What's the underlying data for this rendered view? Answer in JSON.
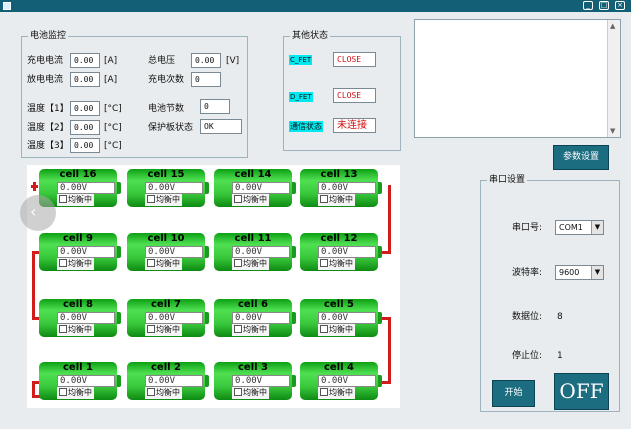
{
  "window": {
    "title": "",
    "controls": [
      "_",
      "□",
      "×"
    ]
  },
  "battery_monitor": {
    "title": "电池监控",
    "charge_current": {
      "label": "充电电流",
      "value": "0.00",
      "unit": "[A]"
    },
    "discharge_current": {
      "label": "放电电流",
      "value": "0.00",
      "unit": "[A]"
    },
    "temp1": {
      "label": "温度【1】",
      "value": "0.00",
      "unit": "[°C]"
    },
    "temp2": {
      "label": "温度【2】",
      "value": "0.00",
      "unit": "[°C]"
    },
    "temp3": {
      "label": "温度【3】",
      "value": "0.00",
      "unit": "[°C]"
    },
    "total_voltage": {
      "label": "总电压",
      "value": "0.00",
      "unit": "[V]"
    },
    "charge_count": {
      "label": "充电次数",
      "value": "0"
    },
    "cell_count": {
      "label": "电池节数",
      "value": "0"
    },
    "protection_status": {
      "label": "保护板状态",
      "value": "OK"
    }
  },
  "other_status": {
    "title": "其他状态",
    "c_fet": {
      "label": "C_FET",
      "value": "CLOSE"
    },
    "d_fet": {
      "label": "D_FET",
      "value": "CLOSE"
    },
    "comm": {
      "label": "通信状态",
      "value": "未连接"
    }
  },
  "param_button": "参数设置",
  "cells": [
    {
      "name": "cell 16",
      "voltage": "0.00V",
      "balance": "均衡中"
    },
    {
      "name": "cell 15",
      "voltage": "0.00V",
      "balance": "均衡中"
    },
    {
      "name": "cell 14",
      "voltage": "0.00V",
      "balance": "均衡中"
    },
    {
      "name": "cell 13",
      "voltage": "0.00V",
      "balance": "均衡中"
    },
    {
      "name": "cell 9",
      "voltage": "0.00V",
      "balance": "均衡中"
    },
    {
      "name": "cell 10",
      "voltage": "0.00V",
      "balance": "均衡中"
    },
    {
      "name": "cell 11",
      "voltage": "0.00V",
      "balance": "均衡中"
    },
    {
      "name": "cell 12",
      "voltage": "0.00V",
      "balance": "均衡中"
    },
    {
      "name": "cell 8",
      "voltage": "0.00V",
      "balance": "均衡中"
    },
    {
      "name": "cell 7",
      "voltage": "0.00V",
      "balance": "均衡中"
    },
    {
      "name": "cell 6",
      "voltage": "0.00V",
      "balance": "均衡中"
    },
    {
      "name": "cell 5",
      "voltage": "0.00V",
      "balance": "均衡中"
    },
    {
      "name": "cell 1",
      "voltage": "0.00V",
      "balance": "均衡中"
    },
    {
      "name": "cell 2",
      "voltage": "0.00V",
      "balance": "均衡中"
    },
    {
      "name": "cell 3",
      "voltage": "0.00V",
      "balance": "均衡中"
    },
    {
      "name": "cell 4",
      "voltage": "0.00V",
      "balance": "均衡中"
    }
  ],
  "serial": {
    "title": "串口设置",
    "port": {
      "label": "串口号:",
      "value": "COM1"
    },
    "baud": {
      "label": "波特率:",
      "value": "9600"
    },
    "data_bits": {
      "label": "数据位:",
      "value": "8"
    },
    "stop_bits": {
      "label": "停止位:",
      "value": "1"
    },
    "open_button": "开始",
    "toggle_button": "OFF"
  }
}
